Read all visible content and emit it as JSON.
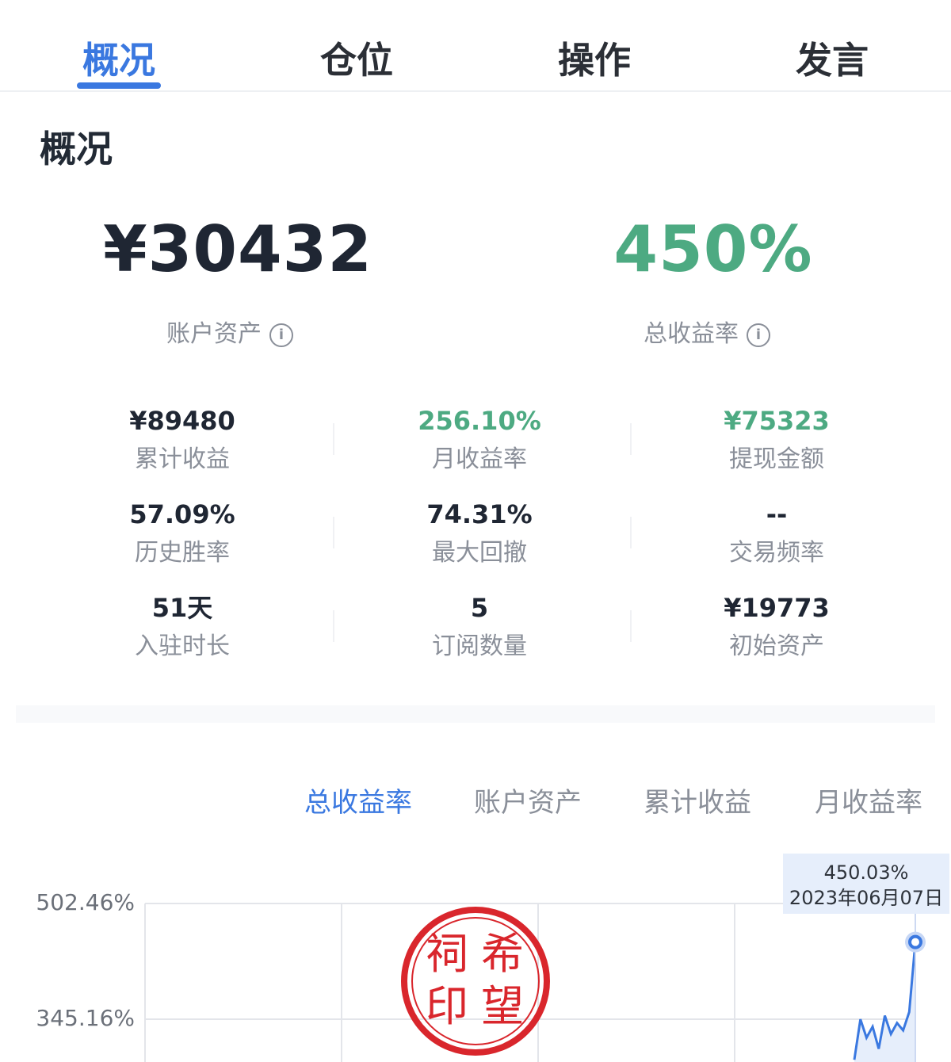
{
  "tabs": [
    {
      "label": "概况",
      "active": true
    },
    {
      "label": "仓位",
      "active": false
    },
    {
      "label": "操作",
      "active": false
    },
    {
      "label": "发言",
      "active": false
    }
  ],
  "section_title": "概况",
  "summary": {
    "assets_value": "¥30432",
    "assets_label": "账户资产",
    "return_value": "450%",
    "return_label": "总收益率",
    "return_color": "#4daa82",
    "info_icon": "ⓘ"
  },
  "stats": [
    {
      "value": "¥89480",
      "label": "累计收益",
      "color": "#1f2633"
    },
    {
      "value": "256.10%",
      "label": "月收益率",
      "color": "#4daa82"
    },
    {
      "value": "¥75323",
      "label": "提现金额",
      "color": "#4daa82"
    },
    {
      "value": "57.09%",
      "label": "历史胜率",
      "color": "#1f2633"
    },
    {
      "value": "74.31%",
      "label": "最大回撤",
      "color": "#1f2633"
    },
    {
      "value": "--",
      "label": "交易频率",
      "color": "#1f2633"
    },
    {
      "value": "51天",
      "label": "入驻时长",
      "color": "#1f2633"
    },
    {
      "value": "5",
      "label": "订阅数量",
      "color": "#1f2633"
    },
    {
      "value": "¥19773",
      "label": "初始资产",
      "color": "#1f2633"
    }
  ],
  "chart_tabs": [
    {
      "label": "总收益率",
      "active": true
    },
    {
      "label": "账户资产",
      "active": false
    },
    {
      "label": "累计收益",
      "active": false
    },
    {
      "label": "月收益率",
      "active": false
    }
  ],
  "chart_data": {
    "type": "line",
    "y_ticks": [
      "502.46%",
      "345.16%"
    ],
    "y_tick_values": [
      502.46,
      345.16
    ],
    "series": [
      {
        "values": [
          290,
          345,
          320,
          335,
          305,
          350,
          325,
          340,
          330,
          355,
          450.03
        ]
      }
    ],
    "tooltip": {
      "value": "450.03%",
      "date": "2023年06月07日"
    },
    "line_color": "#3a78e0"
  },
  "seal": {
    "text": [
      "祠",
      "希",
      "印",
      "望"
    ],
    "color": "#d9262c"
  }
}
